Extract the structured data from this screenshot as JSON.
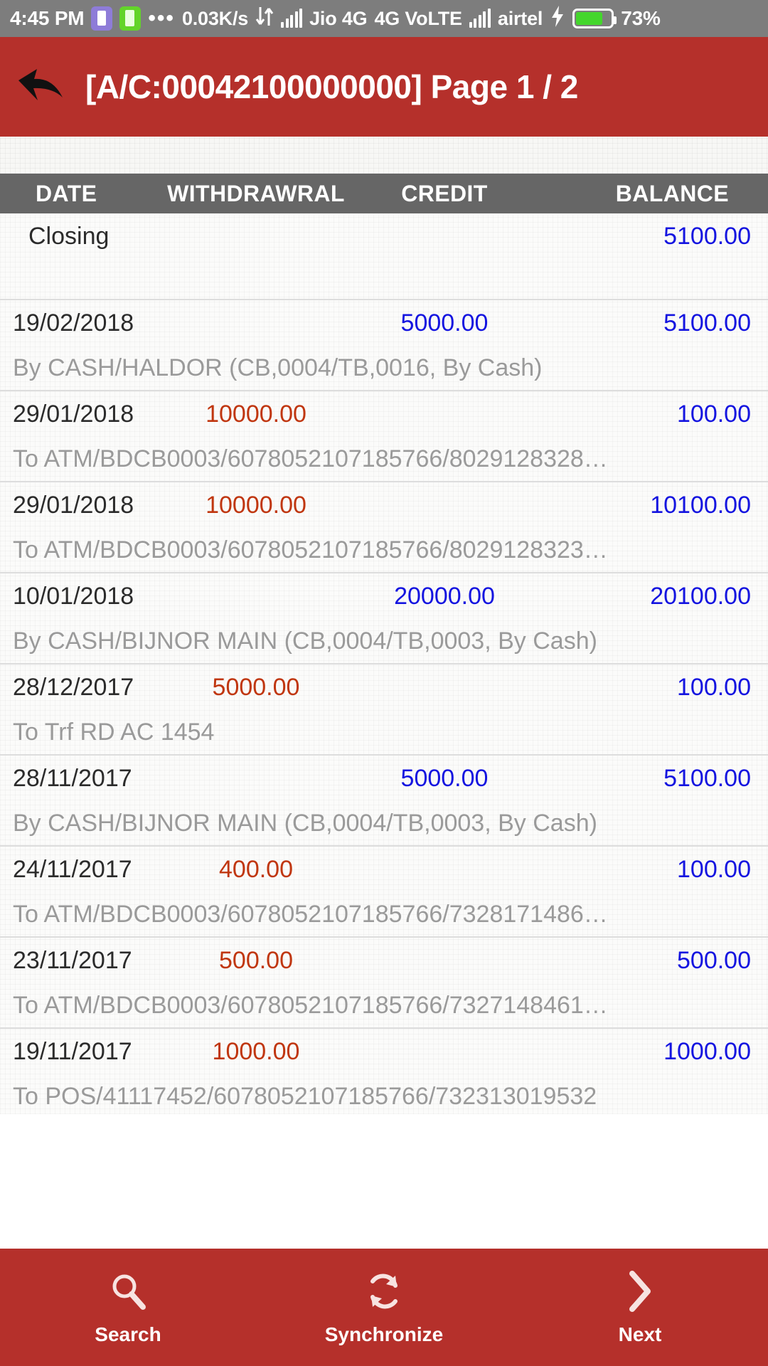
{
  "status_bar": {
    "time": "4:45 PM",
    "dots": "•••",
    "data_speed": "0.03K/s",
    "sim1_label": "Jio 4G",
    "network_type": "4G VoLTE",
    "sim2_label": "airtel",
    "battery_percent": "73%",
    "icons": {
      "app_purple": "app-icon-purple",
      "app_green": "app-icon-green",
      "data_transfer": "data-transfer-icon",
      "signal1": "signal-bars-icon",
      "signal2": "signal-bars-icon",
      "charging": "charging-bolt-icon",
      "battery": "battery-icon"
    }
  },
  "app_bar": {
    "back_icon": "back-arrow-icon",
    "title": "[A/C:00042100000000] Page 1 / 2",
    "background_color": "#b5302b"
  },
  "table": {
    "columns": [
      "DATE",
      "WITHDRAWRAL",
      "CREDIT",
      "BALANCE"
    ],
    "header_background": "#666666",
    "colors": {
      "withdrawal": "#c0360f",
      "credit": "#1414e0",
      "balance": "#1414e0",
      "description": "#9a9a9a",
      "date": "#2b2b2b"
    },
    "rows": [
      {
        "date": "Closing",
        "withdrawal": "",
        "credit": "",
        "balance": "5100.00",
        "description": ""
      },
      {
        "date": "19/02/2018",
        "withdrawal": "",
        "credit": "5000.00",
        "balance": "5100.00",
        "description": "By CASH/HALDOR (CB,0004/TB,0016, By Cash)"
      },
      {
        "date": "29/01/2018",
        "withdrawal": "10000.00",
        "credit": "",
        "balance": "100.00",
        "description": "To ATM/BDCB0003/6078052107185766/8029128328…"
      },
      {
        "date": "29/01/2018",
        "withdrawal": "10000.00",
        "credit": "",
        "balance": "10100.00",
        "description": "To ATM/BDCB0003/6078052107185766/8029128323…"
      },
      {
        "date": "10/01/2018",
        "withdrawal": "",
        "credit": "20000.00",
        "balance": "20100.00",
        "description": "By CASH/BIJNOR MAIN (CB,0004/TB,0003, By Cash)"
      },
      {
        "date": "28/12/2017",
        "withdrawal": "5000.00",
        "credit": "",
        "balance": "100.00",
        "description": "To Trf RD AC 1454"
      },
      {
        "date": "28/11/2017",
        "withdrawal": "",
        "credit": "5000.00",
        "balance": "5100.00",
        "description": "By CASH/BIJNOR MAIN (CB,0004/TB,0003, By Cash)"
      },
      {
        "date": "24/11/2017",
        "withdrawal": "400.00",
        "credit": "",
        "balance": "100.00",
        "description": "To ATM/BDCB0003/6078052107185766/7328171486…"
      },
      {
        "date": "23/11/2017",
        "withdrawal": "500.00",
        "credit": "",
        "balance": "500.00",
        "description": "To ATM/BDCB0003/6078052107185766/7327148461…"
      },
      {
        "date": "19/11/2017",
        "withdrawal": "1000.00",
        "credit": "",
        "balance": "1000.00",
        "description": "To POS/41117452/6078052107185766/732313019532"
      }
    ]
  },
  "bottom_nav": {
    "background_color": "#b5302b",
    "items": [
      {
        "label": "Search",
        "icon": "search-icon"
      },
      {
        "label": "Synchronize",
        "icon": "sync-icon"
      },
      {
        "label": "Next",
        "icon": "chevron-right-icon"
      }
    ]
  }
}
